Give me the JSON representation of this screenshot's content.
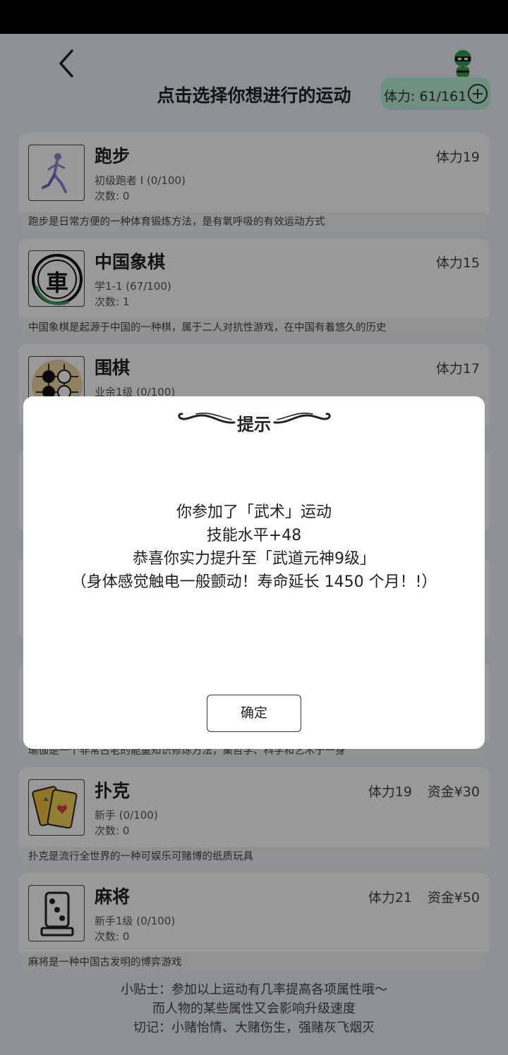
{
  "header": {
    "title": "点击选择你想进行的运动",
    "stamina": "体力: 61/161"
  },
  "sports": [
    {
      "name": "跑步",
      "cost": "体力19",
      "funds": "",
      "level": "初级跑者 I (0/100)",
      "count": "次数: 0",
      "desc": "跑步是日常方便的一种体育锻炼方法，是有氧呼吸的有效运动方式",
      "icon": "running-icon"
    },
    {
      "name": "中国象棋",
      "cost": "体力15",
      "funds": "",
      "level": "学1-1 (67/100)",
      "count": "次数: 1",
      "desc": "中国象棋是起源于中国的一种棋，属于二人对抗性游戏，在中国有着悠久的历史",
      "icon": "chinese-chess-icon",
      "icon_char": "車"
    },
    {
      "name": "围棋",
      "cost": "体力17",
      "funds": "",
      "level": "业余1级 (0/100)",
      "count": "",
      "desc": "",
      "icon": "go-board-icon"
    },
    {
      "name": "",
      "cost": "",
      "funds": "",
      "level": "",
      "count": "",
      "desc": "",
      "icon": ""
    },
    {
      "name": "",
      "cost": "",
      "funds": "",
      "level": "",
      "count": "",
      "desc": "",
      "icon": ""
    },
    {
      "name": "",
      "cost": "",
      "funds": "",
      "level": "",
      "count": "",
      "desc": "瑜伽是一个非常古老的能量知识修炼方法，集哲学、科学和艺术于一身",
      "icon": ""
    },
    {
      "name": "扑克",
      "cost": "体力19",
      "funds": "资金¥30",
      "level": "新手 (0/100)",
      "count": "次数: 0",
      "desc": "扑克是流行全世界的一种可娱乐可赌博的纸质玩具",
      "icon": "poker-cards-icon"
    },
    {
      "name": "麻将",
      "cost": "体力21",
      "funds": "资金¥50",
      "level": "新手1级 (0/100)",
      "count": "次数: 0",
      "desc": "麻将是一种中国古发明的博弈游戏",
      "icon": "mahjong-tile-icon"
    }
  ],
  "tips": [
    "小贴士：参加以上运动有几率提高各项属性哦～",
    "而人物的某些属性又会影响升级速度",
    "切记：小赌怡情、大赌伤生，强赌灰飞烟灭"
  ],
  "dialog": {
    "title": "提示",
    "lines": [
      "你参加了「武术」运动",
      "技能水平+48",
      "恭喜你实力提升至「武道元神9级」",
      "（身体感觉触电一般颤动！寿命延长 1450 个月！!）"
    ],
    "ok_label": "确定"
  },
  "colors": {
    "stamina_pill": "#b9eed8",
    "page_bg": "#ecf1f7",
    "overlay": "rgba(0,0,0,0.40)"
  }
}
